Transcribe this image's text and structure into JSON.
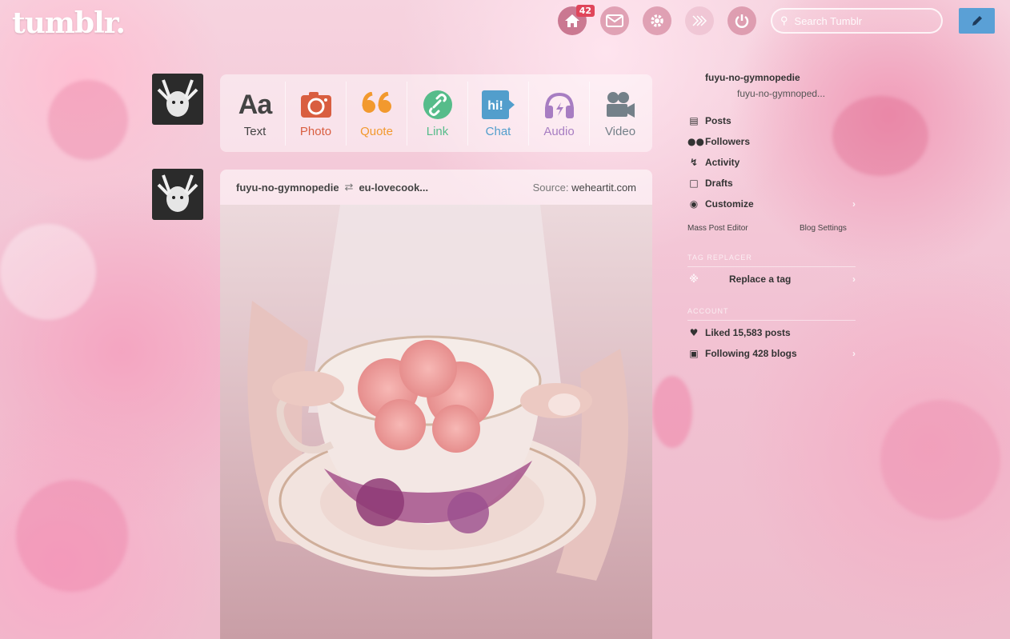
{
  "topbar": {
    "logo": "tumblr.",
    "notifications_count": "42",
    "search_placeholder": "Search Tumblr"
  },
  "post_types": [
    {
      "label": "Text",
      "color": "#444444",
      "icon": "text-icon"
    },
    {
      "label": "Photo",
      "color": "#d95e40",
      "icon": "camera-icon"
    },
    {
      "label": "Quote",
      "color": "#f2992e",
      "icon": "quote-icon"
    },
    {
      "label": "Link",
      "color": "#56bc8a",
      "icon": "link-icon"
    },
    {
      "label": "Chat",
      "color": "#529ecc",
      "icon": "chat-icon"
    },
    {
      "label": "Audio",
      "color": "#a77dc2",
      "icon": "headphones-icon"
    },
    {
      "label": "Video",
      "color": "#748089",
      "icon": "video-camera-icon"
    }
  ],
  "post": {
    "author": "fuyu-no-gymnopedie",
    "reblogged_from": "eu-lovecook...",
    "source_label": "Source:",
    "source_value": "weheartit.com"
  },
  "sidebar": {
    "blog_title": "fuyu-no-gymnopedie",
    "blog_subtitle": "fuyu-no-gymnoped...",
    "items": [
      {
        "label": "Posts",
        "icon": "posts-icon"
      },
      {
        "label": "Followers",
        "icon": "followers-icon"
      },
      {
        "label": "Activity",
        "icon": "activity-icon"
      },
      {
        "label": "Drafts",
        "icon": "drafts-icon"
      },
      {
        "label": "Customize",
        "icon": "eye-icon"
      }
    ],
    "mass_post_editor": "Mass Post Editor",
    "blog_settings": "Blog Settings",
    "tag_replacer_section": "Tag Replacer",
    "replace_tag": "Replace a tag",
    "account_section": "Account",
    "liked": "Liked 15,583 posts",
    "following": "Following 428 blogs"
  }
}
